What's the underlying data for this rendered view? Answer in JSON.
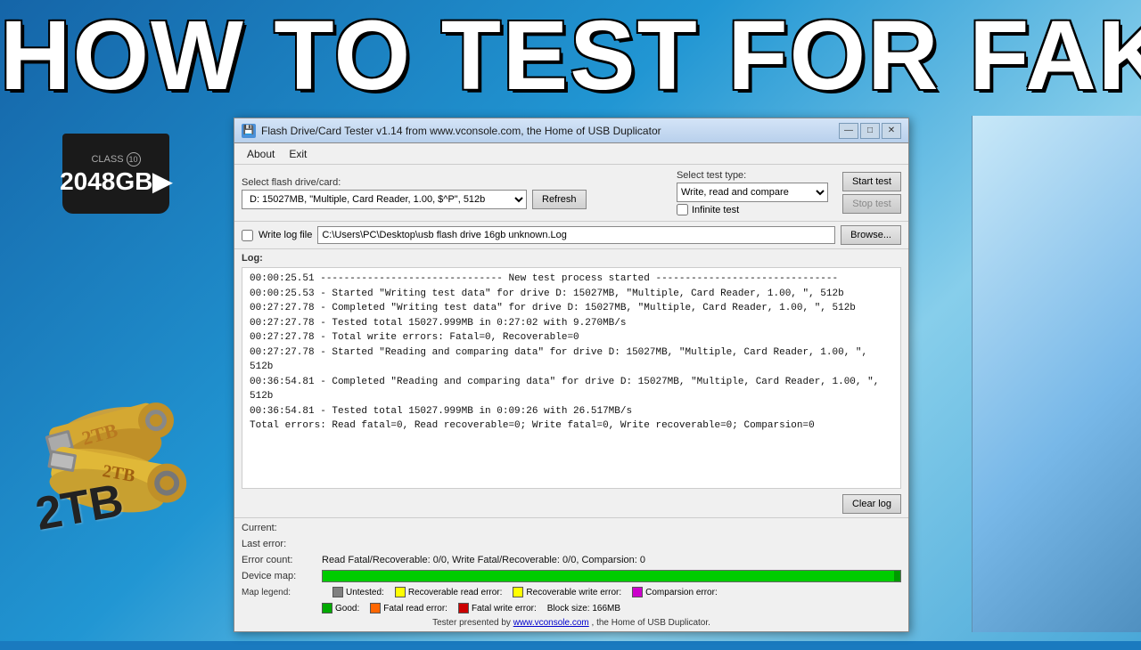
{
  "background": {
    "title": "HOW TO TEST FOR FAKE"
  },
  "titlebar": {
    "text": "Flash Drive/Card Tester v1.14 from www.vconsole.com, the Home of USB Duplicator",
    "minimize": "—",
    "maximize": "□",
    "close": "✕"
  },
  "menubar": {
    "about": "About",
    "exit": "Exit"
  },
  "toolbar": {
    "drive_label": "Select flash drive/card:",
    "drive_value": "D: 15027MB, \"Multiple, Card Reader, 1.00, $^P\", 512b",
    "refresh_label": "Refresh",
    "test_type_label": "Select test type:",
    "test_type_value": "Write, read and compare",
    "infinite_label": "Infinite test",
    "start_label": "Start test",
    "stop_label": "Stop test"
  },
  "logfile": {
    "checkbox_label": "Write log file",
    "path": "C:\\Users\\PC\\Desktop\\usb flash drive 16gb unknown.Log",
    "browse": "Browse..."
  },
  "log": {
    "label": "Log:",
    "lines": [
      "00:00:25.51  ------------------------------- New test process started -------------------------------",
      "00:00:25.53 - Started \"Writing test data\" for drive D: 15027MB, \"Multiple, Card Reader, 1.00, \", 512b",
      "00:27:27.78 - Completed \"Writing test data\" for drive D: 15027MB, \"Multiple, Card Reader, 1.00, \", 512b",
      "00:27:27.78 - Tested total 15027.999MB in 0:27:02 with  9.270MB/s",
      "00:27:27.78 - Total write errors: Fatal=0, Recoverable=0",
      "00:27:27.78 - Started \"Reading and comparing data\" for drive D: 15027MB, \"Multiple, Card Reader, 1.00, \", 512b",
      "00:36:54.81 - Completed \"Reading and comparing data\" for drive D: 15027MB, \"Multiple, Card Reader, 1.00, \", 512b",
      "00:36:54.81 - Tested total 15027.999MB in 0:09:26 with 26.517MB/s",
      "Total errors: Read fatal=0, Read recoverable=0; Write fatal=0, Write recoverable=0; Comparsion=0"
    ],
    "clear_log": "Clear log"
  },
  "status": {
    "current_label": "Current:",
    "current_value": "",
    "last_error_label": "Last error:",
    "last_error_value": "",
    "error_count_label": "Error count:",
    "error_count_value": "Read Fatal/Recoverable: 0/0, Write Fatal/Recoverable: 0/0, Comparsion: 0",
    "device_map_label": "Device map:",
    "map_legend_label": "Map legend:"
  },
  "legend": {
    "untested_label": "Untested:",
    "untested_color": "#808080",
    "good_label": "Good:",
    "good_color": "#00aa00",
    "rec_read_label": "Recoverable read error:",
    "rec_read_color": "#ffff00",
    "fatal_read_label": "Fatal read error:",
    "fatal_read_color": "#ff6600",
    "rec_write_label": "Recoverable write error:",
    "rec_write_color": "#ffff00",
    "fatal_write_label": "Fatal write error:",
    "fatal_write_color": "#cc0000",
    "comparsion_label": "Comparsion error:",
    "comparsion_color": "#cc00cc",
    "block_size_label": "Block size: 166MB"
  },
  "footer": {
    "text1": "Tester presented by ",
    "link": "www.vconsole.com",
    "text2": " , the Home of USB Duplicator."
  }
}
